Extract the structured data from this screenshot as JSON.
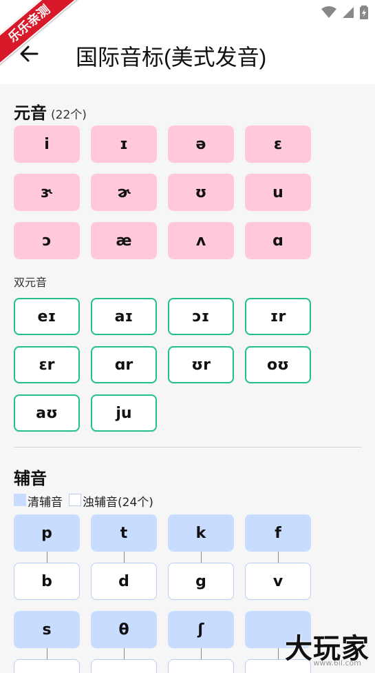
{
  "ribbon": "乐乐亲测",
  "appbar": {
    "title": "国际音标(美式发音)"
  },
  "vowels": {
    "title": "元音",
    "count": "(22个)",
    "monophthongs": [
      "i",
      "ɪ",
      "ə",
      "ɛ",
      "ɝ",
      "ɚ",
      "ʊ",
      "u",
      "ɔ",
      "æ",
      "ʌ",
      "ɑ"
    ],
    "diphthong_label": "双元音",
    "diphthongs": [
      "eɪ",
      "aɪ",
      "ɔɪ",
      "ɪr",
      "ɛr",
      "ɑr",
      "ʊr",
      "oʊ",
      "aʊ",
      "ju"
    ]
  },
  "consonants": {
    "title": "辅音",
    "legend_voiceless": "清辅音",
    "legend_voiced": "浊辅音(24个)",
    "rows": [
      [
        "p",
        "t",
        "k",
        "f"
      ],
      [
        "b",
        "d",
        "g",
        "v"
      ],
      [
        "s",
        "θ",
        "ʃ",
        ""
      ]
    ]
  },
  "watermark": "大玩家",
  "watermark_url": "www.6il.com",
  "colors": {
    "vowel": "#ffc9d9",
    "diphthong_border": "#1fbf8f",
    "voiceless": "#c7dcff",
    "voiced_border": "#b7cdf2"
  }
}
